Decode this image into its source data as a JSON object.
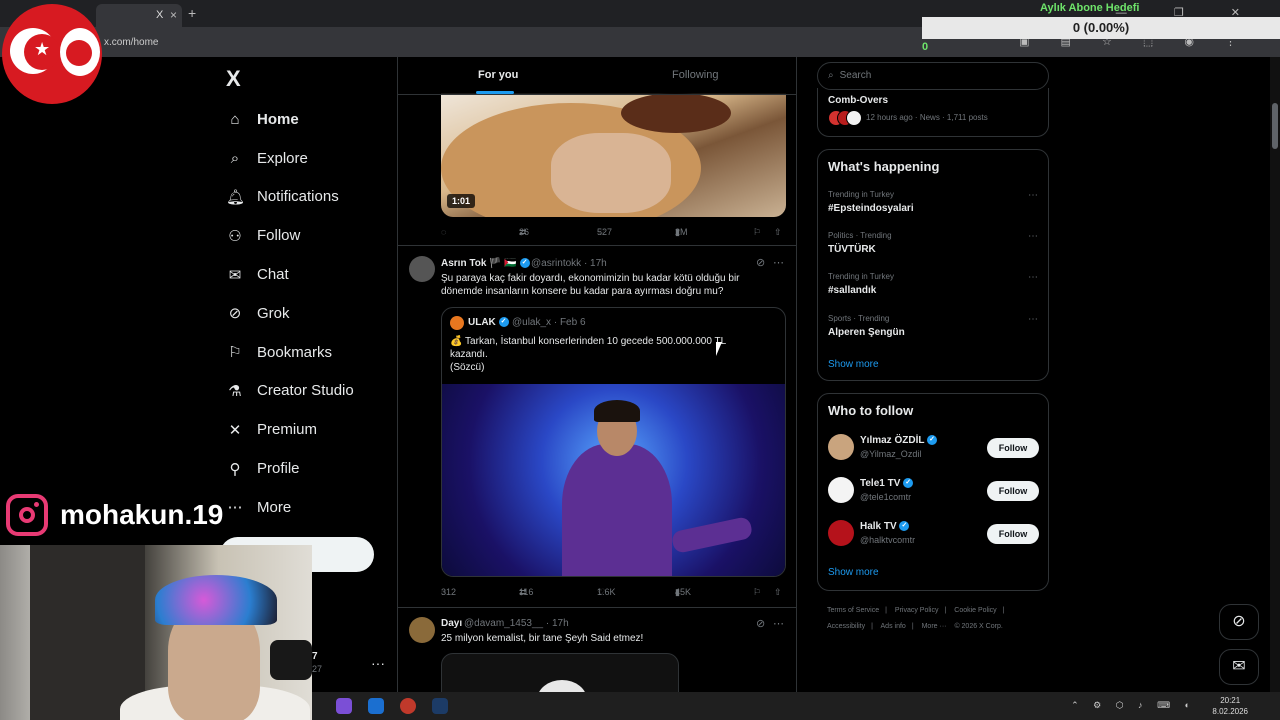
{
  "browser": {
    "tab_title": "X",
    "url": "x.com/home",
    "new_tab": "+",
    "tab_close": "×"
  },
  "stream": {
    "goal_title": "Aylık Abone Hedefi",
    "goal_value": "0 (0.00%)",
    "goal_progress_label": "0",
    "instagram_handle": "mohakun.19"
  },
  "nav": {
    "logo": "X",
    "items": [
      {
        "label": "Home",
        "icon": "home-icon"
      },
      {
        "label": "Explore",
        "icon": "search-icon"
      },
      {
        "label": "Notifications",
        "icon": "bell-icon"
      },
      {
        "label": "Follow",
        "icon": "person-add-icon"
      },
      {
        "label": "Chat",
        "icon": "mail-icon"
      },
      {
        "label": "Grok",
        "icon": "grok-icon"
      },
      {
        "label": "Bookmarks",
        "icon": "bookmark-icon"
      },
      {
        "label": "Creator Studio",
        "icon": "flask-icon"
      },
      {
        "label": "Premium",
        "icon": "x-icon"
      },
      {
        "label": "Profile",
        "icon": "person-icon"
      },
      {
        "label": "More",
        "icon": "more-icon"
      }
    ],
    "account_fragment": "7",
    "account_fragment2": "27",
    "account_menu": "···"
  },
  "feed": {
    "tabs": {
      "for_you": "For you",
      "following": "Following"
    },
    "video1": {
      "duration": "1:01",
      "replies": "",
      "retweets": "26",
      "likes": "527",
      "views": "2M"
    },
    "tweet2": {
      "name": "Asrın Tok",
      "flags": "🏴 🇵🇸",
      "handle": "@asrintokk · 17h",
      "text": "Şu paraya kaç fakir doyardı, ekonomimizin bu kadar kötü olduğu bir dönemde insanların konsere bu kadar para ayırması doğru mu?",
      "quote": {
        "name": "ULAK",
        "handle": "@ulak_x · Feb 6",
        "text": "💰 Tarkan, İstanbul konserlerinden 10 gecede 500.000.000 TL kazandı.",
        "source": "(Sözcü)"
      },
      "replies": "312",
      "retweets": "116",
      "likes": "1.6K",
      "views": "45K"
    },
    "tweet3": {
      "name": "Dayı",
      "handle": "@davam_1453__ · 17h",
      "text": "25 milyon kemalist, bir tane Şeyh Said etmez!"
    }
  },
  "sidebar": {
    "search_placeholder": "Search",
    "news": {
      "title": "Comb-Overs",
      "meta": "12 hours ago · News · 1,711 posts"
    },
    "happening": {
      "heading": "What's happening",
      "trends": [
        {
          "context": "Trending in Turkey",
          "name": "#Epsteindosyalari"
        },
        {
          "context": "Politics · Trending",
          "name": "TÜVTÜRK"
        },
        {
          "context": "Trending in Turkey",
          "name": "#sallandık"
        },
        {
          "context": "Sports · Trending",
          "name": "Alperen Şengün"
        }
      ],
      "show_more": "Show more"
    },
    "who_to_follow": {
      "heading": "Who to follow",
      "accounts": [
        {
          "name": "Yılmaz ÖZDİL",
          "handle": "@Yilmaz_Ozdil",
          "button": "Follow"
        },
        {
          "name": "Tele1 TV",
          "handle": "@tele1comtr",
          "button": "Follow"
        },
        {
          "name": "Halk TV",
          "handle": "@halktvcomtr",
          "button": "Follow"
        }
      ],
      "show_more": "Show more"
    },
    "footer": [
      "Terms of Service",
      "|",
      "Privacy Policy",
      "|",
      "Cookie Policy",
      "|",
      "Accessibility",
      "|",
      "Ads info",
      "|",
      "More ···",
      "© 2026 X Corp."
    ]
  },
  "taskbar": {
    "time": "20:21",
    "date": "8.02.2026"
  },
  "colors": {
    "accent": "#1d9bf0",
    "background": "#000000",
    "goal_green": "#6ee36a"
  }
}
